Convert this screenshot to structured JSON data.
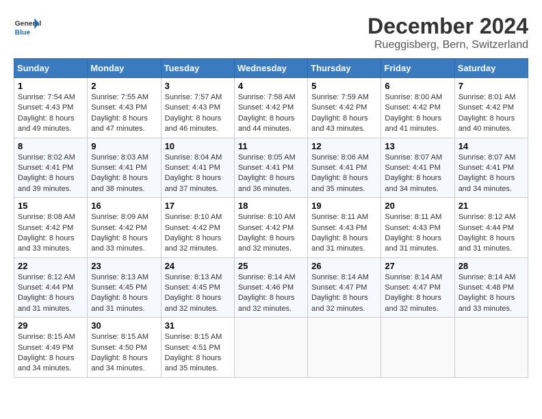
{
  "header": {
    "logo_general": "General",
    "logo_blue": "Blue",
    "month_title": "December 2024",
    "location": "Rueggisberg, Bern, Switzerland"
  },
  "weekdays": [
    "Sunday",
    "Monday",
    "Tuesday",
    "Wednesday",
    "Thursday",
    "Friday",
    "Saturday"
  ],
  "weeks": [
    [
      {
        "day": "1",
        "sunrise": "7:54 AM",
        "sunset": "4:43 PM",
        "daylight": "8 hours and 49 minutes."
      },
      {
        "day": "2",
        "sunrise": "7:55 AM",
        "sunset": "4:43 PM",
        "daylight": "8 hours and 47 minutes."
      },
      {
        "day": "3",
        "sunrise": "7:57 AM",
        "sunset": "4:43 PM",
        "daylight": "8 hours and 46 minutes."
      },
      {
        "day": "4",
        "sunrise": "7:58 AM",
        "sunset": "4:42 PM",
        "daylight": "8 hours and 44 minutes."
      },
      {
        "day": "5",
        "sunrise": "7:59 AM",
        "sunset": "4:42 PM",
        "daylight": "8 hours and 43 minutes."
      },
      {
        "day": "6",
        "sunrise": "8:00 AM",
        "sunset": "4:42 PM",
        "daylight": "8 hours and 41 minutes."
      },
      {
        "day": "7",
        "sunrise": "8:01 AM",
        "sunset": "4:42 PM",
        "daylight": "8 hours and 40 minutes."
      }
    ],
    [
      {
        "day": "8",
        "sunrise": "8:02 AM",
        "sunset": "4:41 PM",
        "daylight": "8 hours and 39 minutes."
      },
      {
        "day": "9",
        "sunrise": "8:03 AM",
        "sunset": "4:41 PM",
        "daylight": "8 hours and 38 minutes."
      },
      {
        "day": "10",
        "sunrise": "8:04 AM",
        "sunset": "4:41 PM",
        "daylight": "8 hours and 37 minutes."
      },
      {
        "day": "11",
        "sunrise": "8:05 AM",
        "sunset": "4:41 PM",
        "daylight": "8 hours and 36 minutes."
      },
      {
        "day": "12",
        "sunrise": "8:06 AM",
        "sunset": "4:41 PM",
        "daylight": "8 hours and 35 minutes."
      },
      {
        "day": "13",
        "sunrise": "8:07 AM",
        "sunset": "4:41 PM",
        "daylight": "8 hours and 34 minutes."
      },
      {
        "day": "14",
        "sunrise": "8:07 AM",
        "sunset": "4:41 PM",
        "daylight": "8 hours and 34 minutes."
      }
    ],
    [
      {
        "day": "15",
        "sunrise": "8:08 AM",
        "sunset": "4:42 PM",
        "daylight": "8 hours and 33 minutes."
      },
      {
        "day": "16",
        "sunrise": "8:09 AM",
        "sunset": "4:42 PM",
        "daylight": "8 hours and 33 minutes."
      },
      {
        "day": "17",
        "sunrise": "8:10 AM",
        "sunset": "4:42 PM",
        "daylight": "8 hours and 32 minutes."
      },
      {
        "day": "18",
        "sunrise": "8:10 AM",
        "sunset": "4:42 PM",
        "daylight": "8 hours and 32 minutes."
      },
      {
        "day": "19",
        "sunrise": "8:11 AM",
        "sunset": "4:43 PM",
        "daylight": "8 hours and 31 minutes."
      },
      {
        "day": "20",
        "sunrise": "8:11 AM",
        "sunset": "4:43 PM",
        "daylight": "8 hours and 31 minutes."
      },
      {
        "day": "21",
        "sunrise": "8:12 AM",
        "sunset": "4:44 PM",
        "daylight": "8 hours and 31 minutes."
      }
    ],
    [
      {
        "day": "22",
        "sunrise": "8:12 AM",
        "sunset": "4:44 PM",
        "daylight": "8 hours and 31 minutes."
      },
      {
        "day": "23",
        "sunrise": "8:13 AM",
        "sunset": "4:45 PM",
        "daylight": "8 hours and 31 minutes."
      },
      {
        "day": "24",
        "sunrise": "8:13 AM",
        "sunset": "4:45 PM",
        "daylight": "8 hours and 32 minutes."
      },
      {
        "day": "25",
        "sunrise": "8:14 AM",
        "sunset": "4:46 PM",
        "daylight": "8 hours and 32 minutes."
      },
      {
        "day": "26",
        "sunrise": "8:14 AM",
        "sunset": "4:47 PM",
        "daylight": "8 hours and 32 minutes."
      },
      {
        "day": "27",
        "sunrise": "8:14 AM",
        "sunset": "4:47 PM",
        "daylight": "8 hours and 32 minutes."
      },
      {
        "day": "28",
        "sunrise": "8:14 AM",
        "sunset": "4:48 PM",
        "daylight": "8 hours and 33 minutes."
      }
    ],
    [
      {
        "day": "29",
        "sunrise": "8:15 AM",
        "sunset": "4:49 PM",
        "daylight": "8 hours and 34 minutes."
      },
      {
        "day": "30",
        "sunrise": "8:15 AM",
        "sunset": "4:50 PM",
        "daylight": "8 hours and 34 minutes."
      },
      {
        "day": "31",
        "sunrise": "8:15 AM",
        "sunset": "4:51 PM",
        "daylight": "8 hours and 35 minutes."
      },
      null,
      null,
      null,
      null
    ]
  ]
}
